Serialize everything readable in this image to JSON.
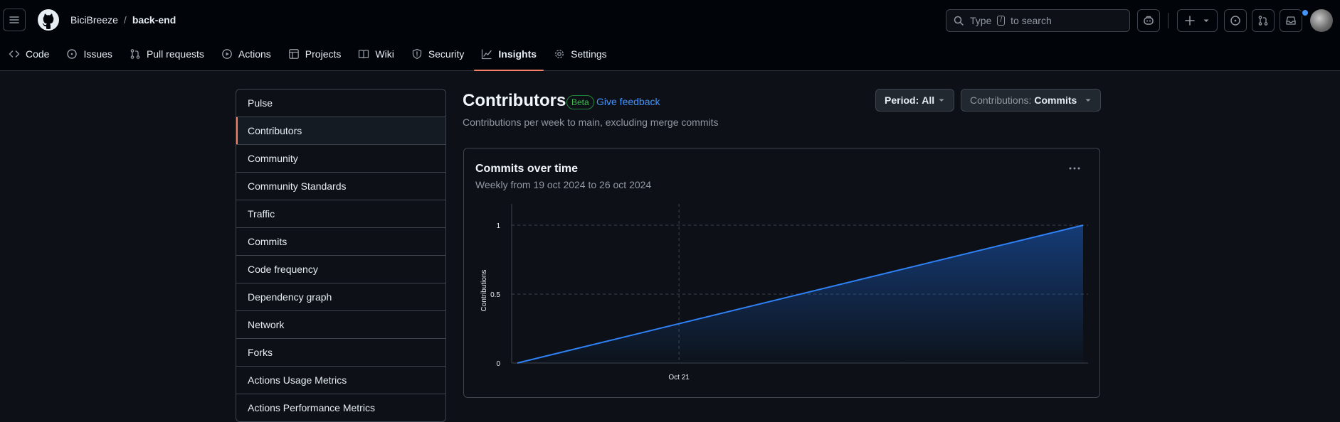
{
  "header": {
    "owner": "BiciBreeze",
    "separator": "/",
    "repo": "back-end",
    "search": {
      "prefix": "Type",
      "key": "/",
      "suffix": "to search"
    }
  },
  "tabs": [
    {
      "label": "Code",
      "icon": "code-icon"
    },
    {
      "label": "Issues",
      "icon": "issue-icon"
    },
    {
      "label": "Pull requests",
      "icon": "pull-request-icon"
    },
    {
      "label": "Actions",
      "icon": "play-icon"
    },
    {
      "label": "Projects",
      "icon": "table-icon"
    },
    {
      "label": "Wiki",
      "icon": "book-icon"
    },
    {
      "label": "Security",
      "icon": "shield-icon"
    },
    {
      "label": "Insights",
      "icon": "graph-icon",
      "active": true
    },
    {
      "label": "Settings",
      "icon": "gear-icon"
    }
  ],
  "sidebar": {
    "items": [
      {
        "label": "Pulse"
      },
      {
        "label": "Contributors",
        "selected": true
      },
      {
        "label": "Community"
      },
      {
        "label": "Community Standards"
      },
      {
        "label": "Traffic"
      },
      {
        "label": "Commits"
      },
      {
        "label": "Code frequency"
      },
      {
        "label": "Dependency graph"
      },
      {
        "label": "Network"
      },
      {
        "label": "Forks"
      },
      {
        "label": "Actions Usage Metrics"
      },
      {
        "label": "Actions Performance Metrics"
      }
    ]
  },
  "main": {
    "title": "Contributors",
    "badge": "Beta",
    "feedback": "Give feedback",
    "subtitle": "Contributions per week to main, excluding merge commits",
    "period": {
      "label": "Period:",
      "value": "All"
    },
    "contributions": {
      "label": "Contributions:",
      "value": "Commits"
    }
  },
  "card": {
    "title": "Commits over time",
    "subtitle": "Weekly from 19 oct 2024 to 26 oct 2024"
  },
  "colors": {
    "accent": "#f78166",
    "link": "#4493f8",
    "line": "#2f81f7",
    "badge": "#3fb950"
  },
  "chart_data": {
    "type": "area",
    "x": [
      "2024-10-19",
      "2024-10-26"
    ],
    "values": [
      0,
      1
    ],
    "x_ticks": [
      {
        "label": "Oct 21",
        "date": "2024-10-21"
      }
    ],
    "y_ticks": [
      0,
      0.5,
      1
    ],
    "ylabel": "Contributions",
    "ylim": [
      0,
      1
    ],
    "grid": "horizontal dashed"
  }
}
